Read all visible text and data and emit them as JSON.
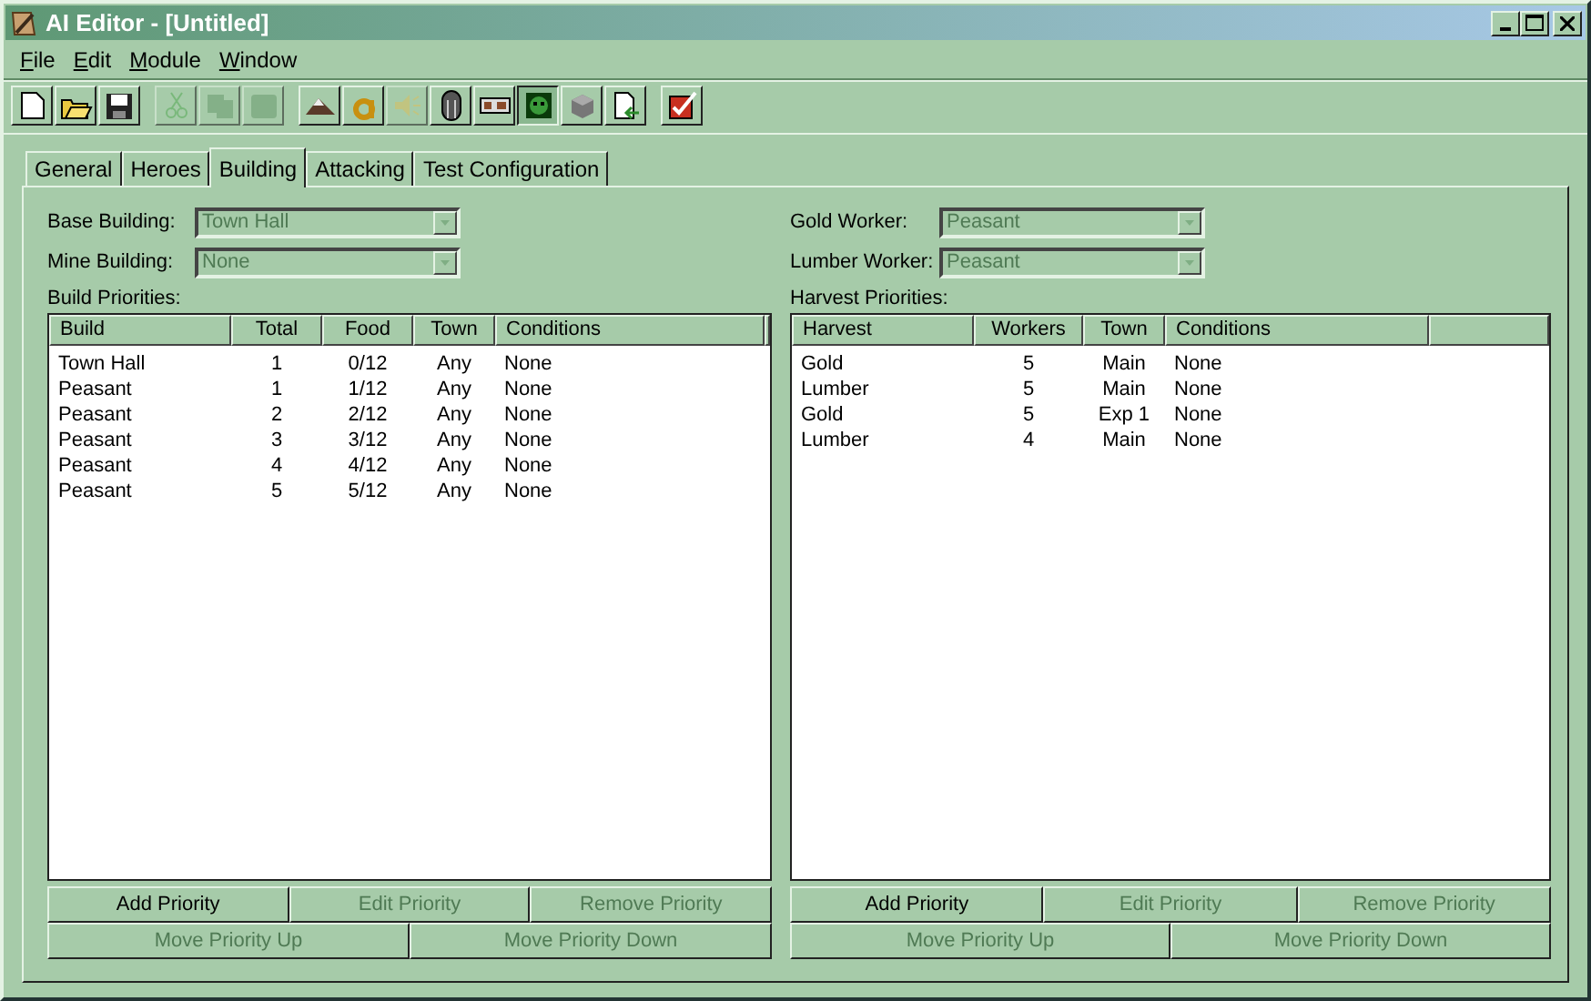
{
  "window": {
    "title": "AI Editor - [Untitled]"
  },
  "menu": [
    "File",
    "Edit",
    "Module",
    "Window"
  ],
  "toolbar": [
    [
      {
        "disabled": false,
        "selected": false
      },
      {
        "disabled": false,
        "selected": false
      },
      {
        "disabled": false,
        "selected": false
      }
    ],
    [
      {
        "disabled": true,
        "selected": false
      },
      {
        "disabled": true,
        "selected": false
      },
      {
        "disabled": true,
        "selected": false
      }
    ],
    [
      {
        "disabled": false,
        "selected": false
      },
      {
        "disabled": false,
        "selected": false
      },
      {
        "disabled": true,
        "selected": false
      },
      {
        "disabled": false,
        "selected": false
      },
      {
        "disabled": false,
        "selected": false
      },
      {
        "disabled": false,
        "selected": true
      },
      {
        "disabled": false,
        "selected": false
      },
      {
        "disabled": false,
        "selected": false
      }
    ],
    [
      {
        "disabled": false,
        "selected": false
      }
    ]
  ],
  "tabs": [
    {
      "label": "General",
      "selected": false
    },
    {
      "label": "Heroes",
      "selected": false
    },
    {
      "label": "Building",
      "selected": true
    },
    {
      "label": "Attacking",
      "selected": false
    },
    {
      "label": "Test Configuration",
      "selected": false
    }
  ],
  "panels": [
    {
      "fields": [
        {
          "label": "Base Building:",
          "value": "Town Hall",
          "disabled": true
        },
        {
          "label": "Mine Building:",
          "value": "None",
          "disabled": true
        }
      ],
      "list_label": "Build Priorities:",
      "columns": [
        "Build",
        "Total",
        "Food",
        "Town",
        "Conditions"
      ],
      "rows": [
        [
          "Town Hall",
          "1",
          "0/12",
          "Any",
          "None"
        ],
        [
          "Peasant",
          "1",
          "1/12",
          "Any",
          "None"
        ],
        [
          "Peasant",
          "2",
          "2/12",
          "Any",
          "None"
        ],
        [
          "Peasant",
          "3",
          "3/12",
          "Any",
          "None"
        ],
        [
          "Peasant",
          "4",
          "4/12",
          "Any",
          "None"
        ],
        [
          "Peasant",
          "5",
          "5/12",
          "Any",
          "None"
        ]
      ],
      "buttons": [
        [
          {
            "label": "Add Priority",
            "disabled": false
          },
          {
            "label": "Edit Priority",
            "disabled": true
          },
          {
            "label": "Remove Priority",
            "disabled": true
          }
        ],
        [
          {
            "label": "Move Priority Up",
            "disabled": true
          },
          {
            "label": "Move Priority Down",
            "disabled": true
          }
        ]
      ]
    },
    {
      "fields": [
        {
          "label": "Gold Worker:",
          "value": "Peasant",
          "disabled": true
        },
        {
          "label": "Lumber Worker:",
          "value": "Peasant",
          "disabled": true
        }
      ],
      "list_label": "Harvest Priorities:",
      "columns": [
        "Harvest",
        "Workers",
        "Town",
        "Conditions"
      ],
      "rows": [
        [
          "Gold",
          "5",
          "Main",
          "None"
        ],
        [
          "Lumber",
          "5",
          "Main",
          "None"
        ],
        [
          "Gold",
          "5",
          "Exp 1",
          "None"
        ],
        [
          "Lumber",
          "4",
          "Main",
          "None"
        ]
      ],
      "buttons": [
        [
          {
            "label": "Add Priority",
            "disabled": false
          },
          {
            "label": "Edit Priority",
            "disabled": true
          },
          {
            "label": "Remove Priority",
            "disabled": true
          }
        ],
        [
          {
            "label": "Move Priority Up",
            "disabled": true
          },
          {
            "label": "Move Priority Down",
            "disabled": true
          }
        ]
      ]
    }
  ]
}
